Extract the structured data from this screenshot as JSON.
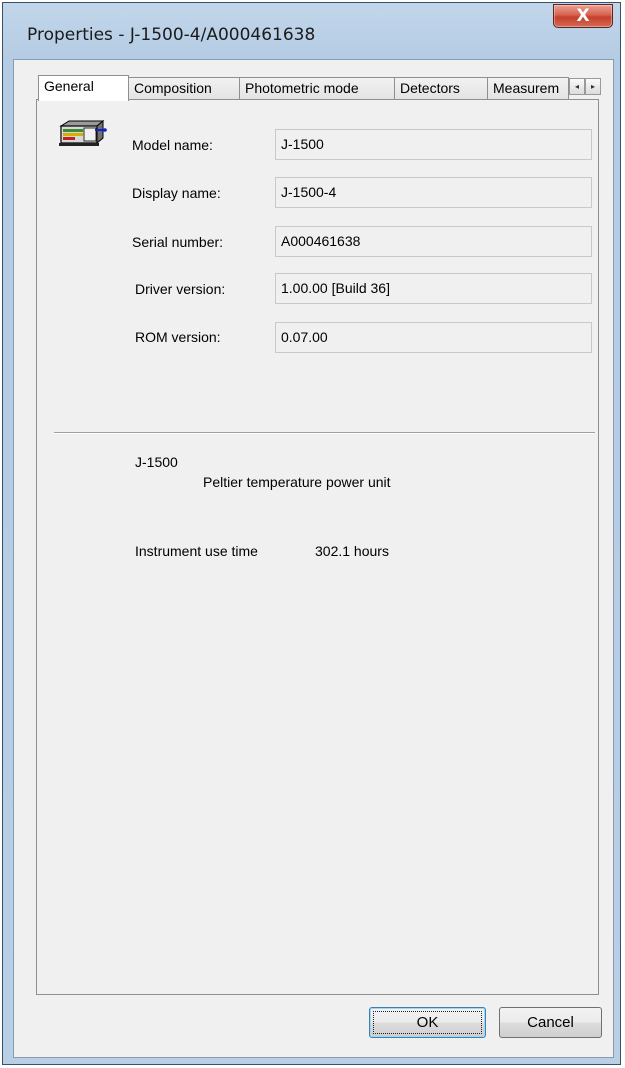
{
  "window": {
    "title": "Properties - J-1500-4/A000461638",
    "close_glyph": "X"
  },
  "tabs": [
    {
      "label": "General",
      "active": true
    },
    {
      "label": "Composition",
      "active": false
    },
    {
      "label": "Photometric mode",
      "active": false
    },
    {
      "label": "Detectors",
      "active": false
    },
    {
      "label": "Measurem",
      "active": false
    }
  ],
  "tab_scroll": {
    "left_icon": "scroll-left-arrow-icon",
    "right_icon": "scroll-right-arrow-icon",
    "left": "◂",
    "right": "▸"
  },
  "general": {
    "icon": "spectrometer-device-icon",
    "fields": [
      {
        "label": "Model name:",
        "value": "J-1500"
      },
      {
        "label": "Display name:",
        "value": "J-1500-4"
      },
      {
        "label": "Serial number:",
        "value": "A000461638"
      },
      {
        "label": "Driver version:",
        "value": "1.00.00 [Build 36]"
      },
      {
        "label": "ROM version:",
        "value": "0.07.00"
      }
    ],
    "model": "J-1500",
    "accessory": "Peltier temperature power unit",
    "use_time_label": "Instrument use time",
    "use_time_value": "302.1 hours"
  },
  "buttons": {
    "ok": "OK",
    "cancel": "Cancel"
  },
  "colors": {
    "close_button": "#c4402c",
    "default_button_border": "#3c7fb1"
  }
}
